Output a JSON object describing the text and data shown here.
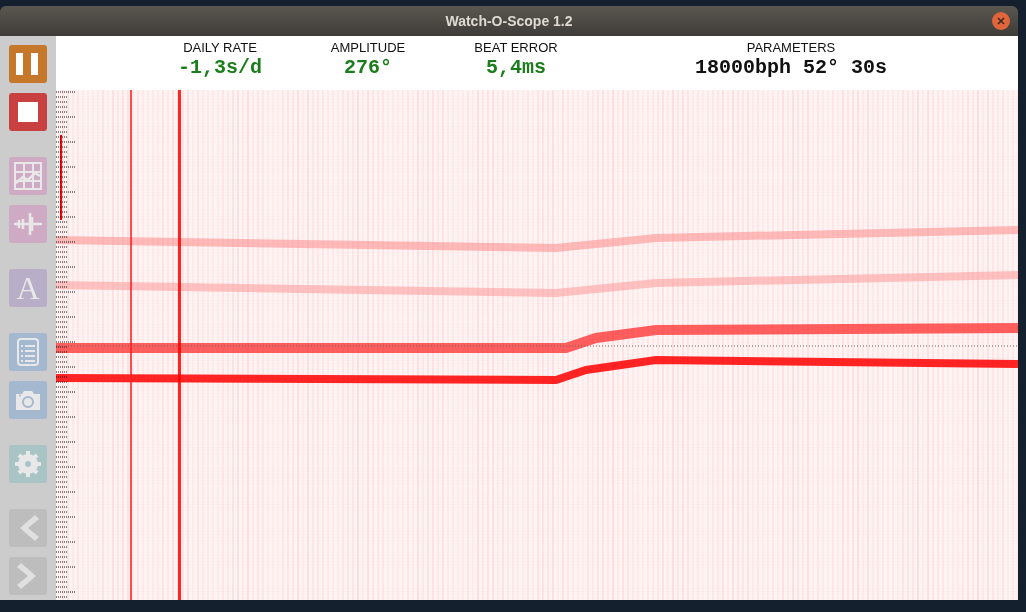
{
  "window": {
    "title": "Watch-O-Scope 1.2"
  },
  "toolbar": [
    {
      "kind": "pause"
    },
    {
      "kind": "stop"
    },
    {
      "kind": "chart"
    },
    {
      "kind": "waveform"
    },
    {
      "kind": "text",
      "glyph": "A"
    },
    {
      "kind": "list"
    },
    {
      "kind": "camera"
    },
    {
      "kind": "settings"
    },
    {
      "kind": "back"
    },
    {
      "kind": "forward"
    }
  ],
  "readouts": [
    {
      "label": "DAILY RATE",
      "value": "-1,3s/d",
      "kind": "measure"
    },
    {
      "label": "AMPLITUDE",
      "value": "276°",
      "kind": "measure"
    },
    {
      "label": "BEAT ERROR",
      "value": "5,4ms",
      "kind": "measure"
    },
    {
      "label": "PARAMETERS",
      "value": "18000bph 52° 30s",
      "kind": "setting"
    }
  ]
}
